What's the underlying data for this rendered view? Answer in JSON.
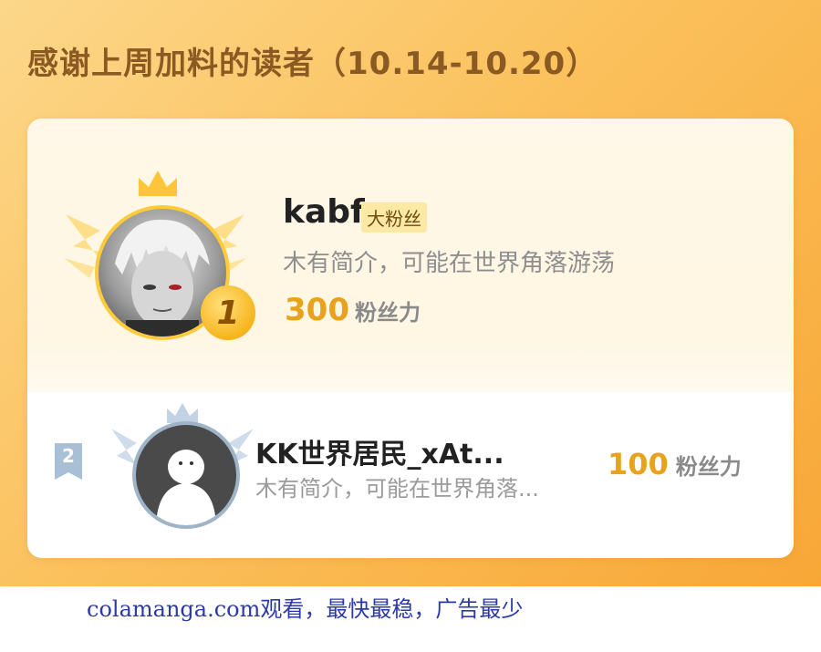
{
  "header": {
    "title": "感谢上周加料的读者（10.14-10.20）"
  },
  "first": {
    "rank": "1",
    "name": "kabf",
    "tag": "大粉丝",
    "bio": "木有简介，可能在世界角落游荡",
    "score": "300",
    "score_unit": "粉丝力"
  },
  "second": {
    "rank": "2",
    "name": "KK世界居民_xAt...",
    "bio": "木有简介，可能在世界角落...",
    "score": "100",
    "score_unit": "粉丝力"
  },
  "footer": {
    "watermark": "colamanga.com观看，最快最稳，广告最少"
  },
  "colors": {
    "accent": "#e8a21b",
    "panel": "#fbc15d",
    "gold": "#ffcb3a",
    "silver": "#9fb4c8"
  }
}
